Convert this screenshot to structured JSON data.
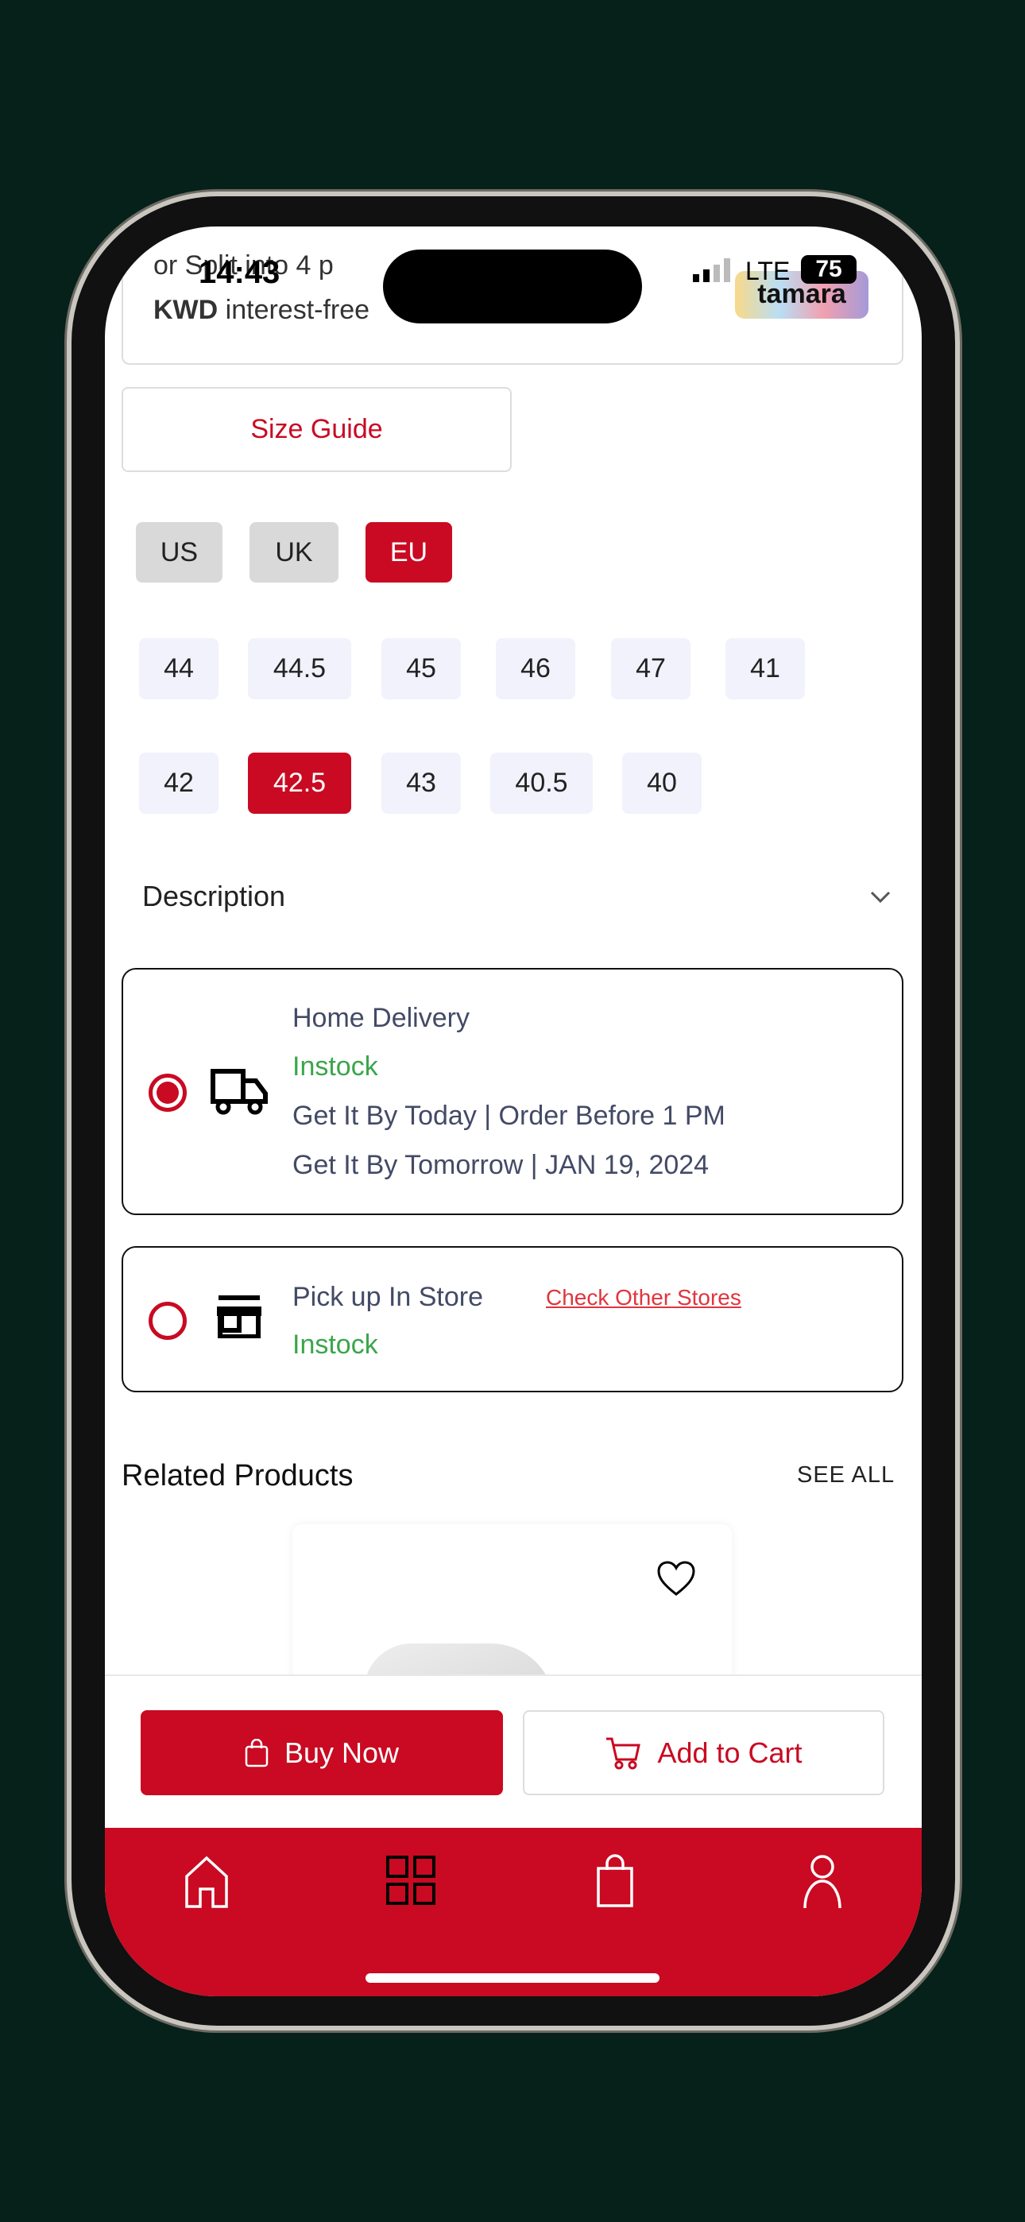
{
  "status_bar": {
    "time": "14:43",
    "network": "LTE",
    "battery": "75"
  },
  "tamara": {
    "line1": "or Split into 4 p",
    "line2_bold": "KWD",
    "line2": "interest-free",
    "logo": "tamara"
  },
  "size_guide": "Size Guide",
  "size_systems": [
    {
      "label": "US",
      "selected": false
    },
    {
      "label": "UK",
      "selected": false
    },
    {
      "label": "EU",
      "selected": true
    }
  ],
  "sizes": [
    "44",
    "44.5",
    "45",
    "46",
    "47",
    "41",
    "42",
    "42.5",
    "43",
    "40.5",
    "40"
  ],
  "selected_size": "42.5",
  "description": {
    "label": "Description",
    "icon": "chevron-down-icon"
  },
  "delivery": {
    "home": {
      "title": "Home Delivery",
      "stock": "Instock",
      "line1": "Get It By Today | Order Before 1 PM",
      "line2": "Get It By Tomorrow | JAN 19, 2024",
      "selected": true
    },
    "pickup": {
      "title": "Pick up In Store",
      "link": "Check Other Stores",
      "stock": "Instock",
      "selected": false
    }
  },
  "related": {
    "title": "Related Products",
    "see_all": "SEE ALL"
  },
  "actions": {
    "buy_now": "Buy Now",
    "add_to_cart": "Add to Cart"
  },
  "nav": [
    "home-icon",
    "categories-icon",
    "bag-icon",
    "profile-icon"
  ],
  "colors": {
    "brand": "#c90a22",
    "instock": "#3aa64a",
    "text": "#434a66"
  }
}
